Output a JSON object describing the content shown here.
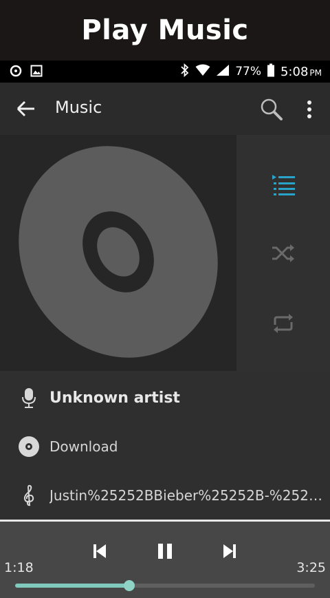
{
  "banner": {
    "title": "Play Music"
  },
  "statusbar": {
    "battery": "77%",
    "time": "5:08",
    "ampm": "PM"
  },
  "appbar": {
    "title": "Music"
  },
  "track_info": {
    "artist": "Unknown artist",
    "album": "Download",
    "title": "Justin%25252BBieber%25252B-%25252B…"
  },
  "player": {
    "elapsed": "1:18",
    "duration": "3:25",
    "progress_fraction": 0.38
  },
  "colors": {
    "accent": "#29a3c9",
    "progress": "#7fc9bd",
    "control_bar": "#474747"
  }
}
